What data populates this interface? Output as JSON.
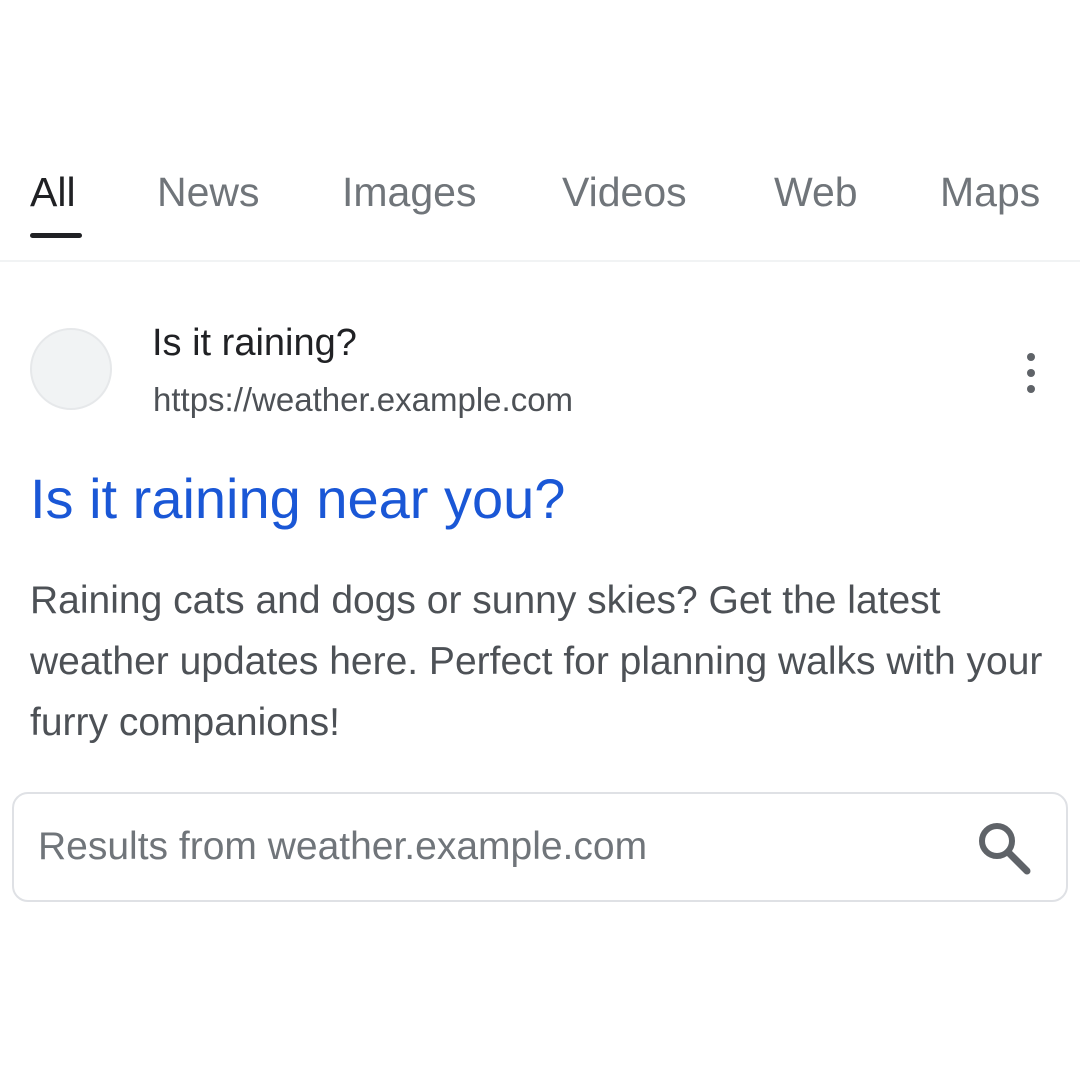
{
  "tabs": [
    {
      "label": "All",
      "active": true
    },
    {
      "label": "News",
      "active": false
    },
    {
      "label": "Images",
      "active": false
    },
    {
      "label": "Videos",
      "active": false
    },
    {
      "label": "Web",
      "active": false
    },
    {
      "label": "Maps",
      "active": false
    }
  ],
  "result": {
    "site_name": "Is it raining?",
    "site_url": "https://weather.example.com",
    "title": "Is it raining near you?",
    "snippet": "Raining cats and dogs or sunny skies? Get the latest weather updates here. Perfect for planning walks with your furry companions!",
    "more_icon": "more-vert-icon",
    "favicon_icon": "site-favicon-placeholder"
  },
  "site_search": {
    "placeholder": "Results from weather.example.com",
    "value": "",
    "icon": "search-icon"
  },
  "colors": {
    "link": "#1a57d6",
    "text_primary": "#202124",
    "text_secondary": "#4d5156",
    "tab_inactive": "#70757a",
    "border": "#dfe1e5"
  }
}
